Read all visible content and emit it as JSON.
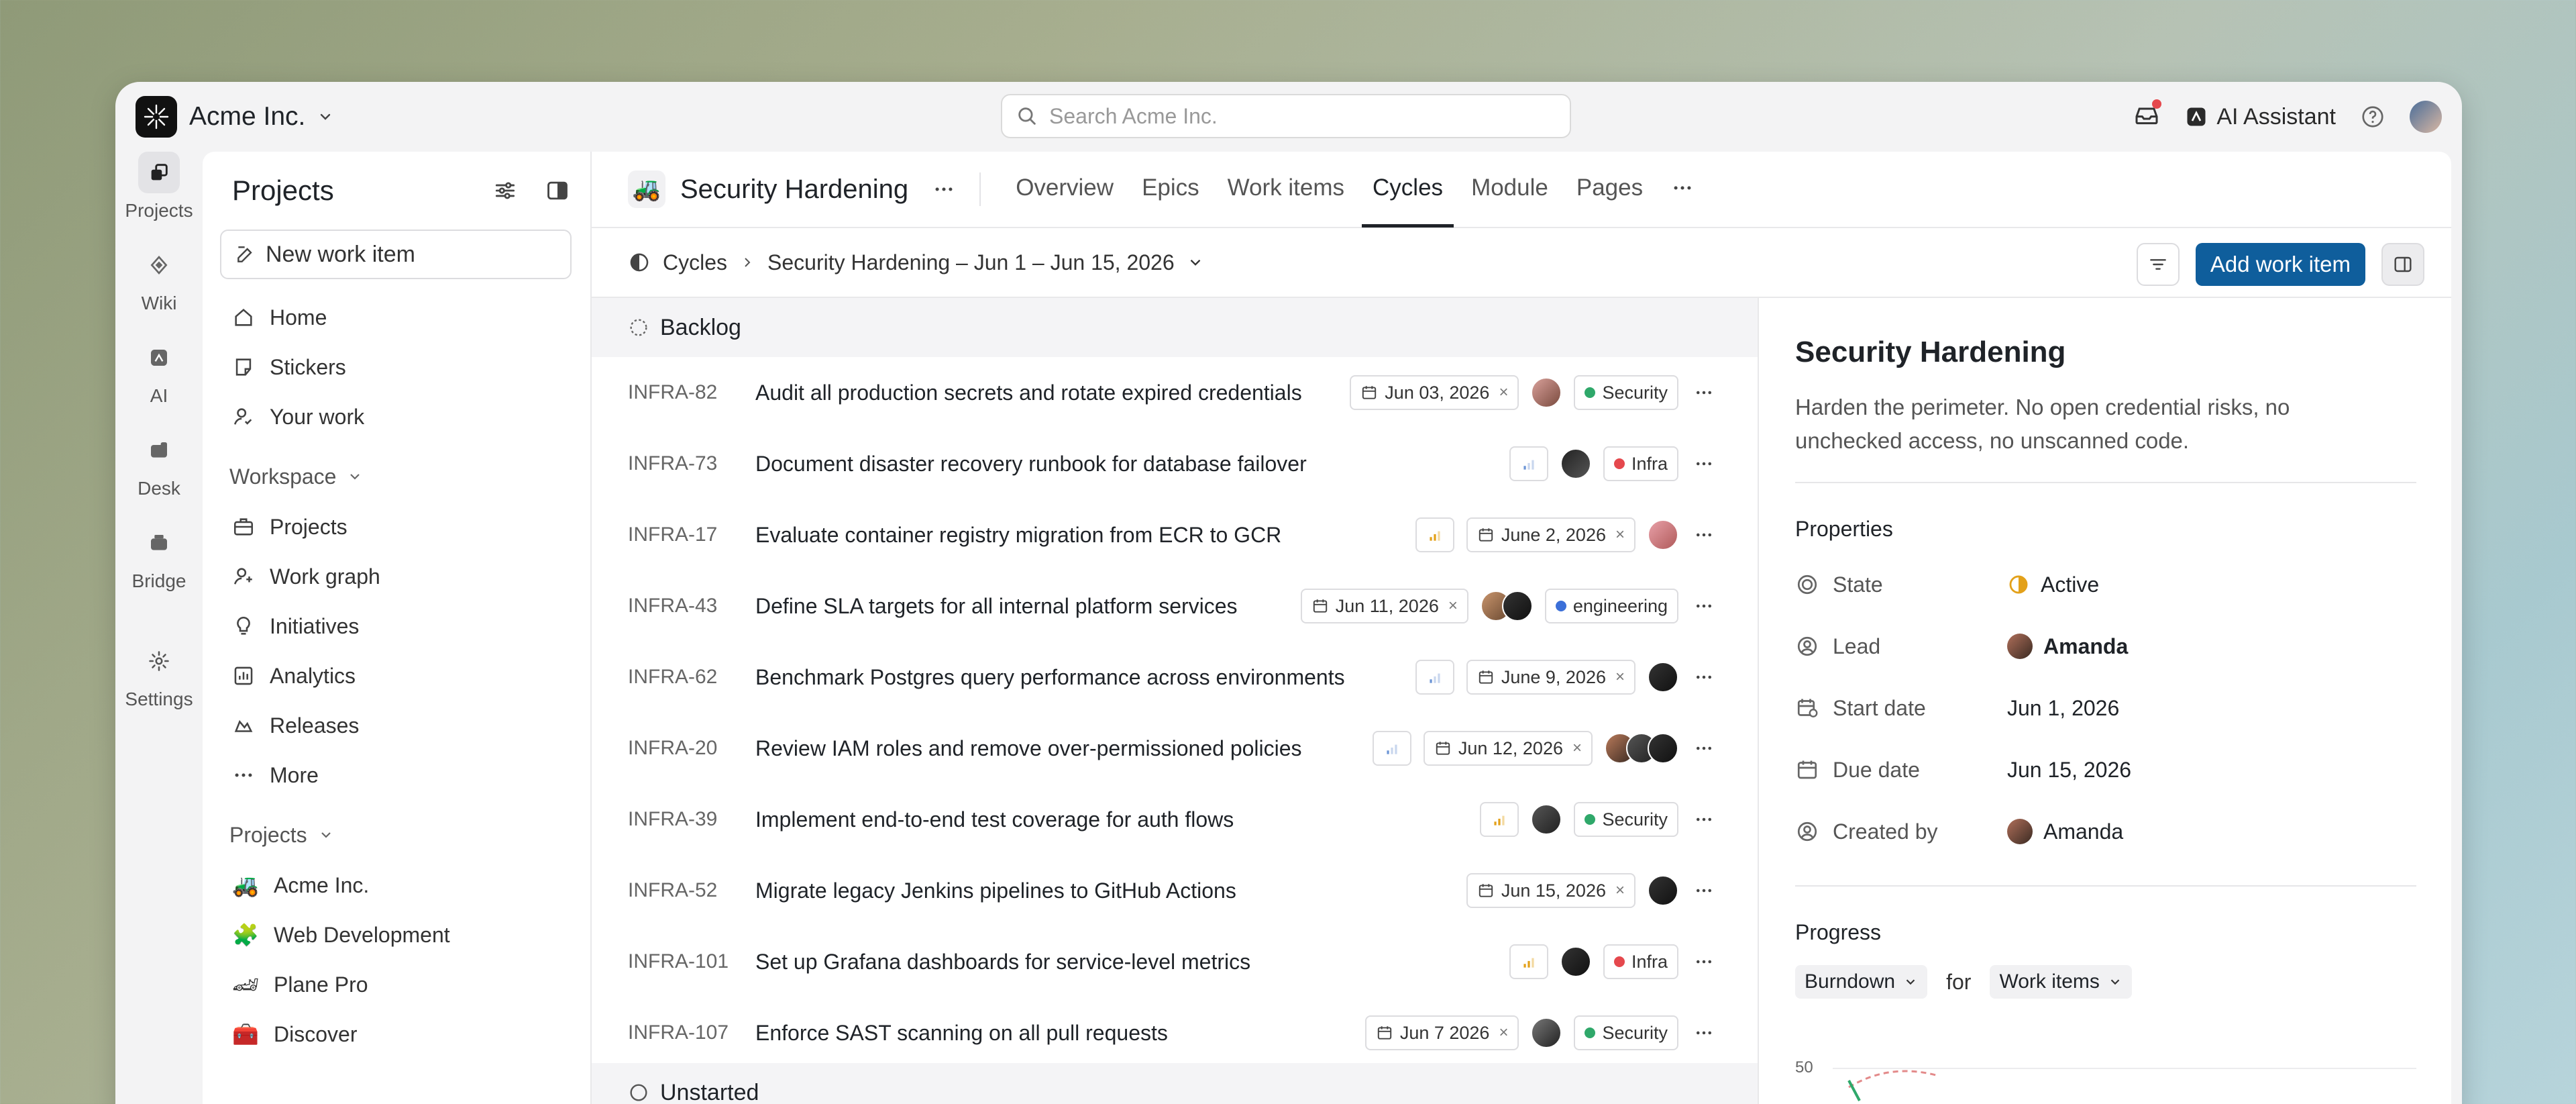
{
  "org": {
    "name": "Acme Inc."
  },
  "search": {
    "placeholder": "Search Acme Inc."
  },
  "topbar": {
    "ai_label": "AI Assistant"
  },
  "rail": [
    {
      "label": "Projects",
      "icon": "projects-icon"
    },
    {
      "label": "Wiki",
      "icon": "wiki-icon"
    },
    {
      "label": "AI",
      "icon": "ai-icon"
    },
    {
      "label": "Desk",
      "icon": "desk-icon"
    },
    {
      "label": "Bridge",
      "icon": "bridge-icon"
    },
    {
      "label": "Settings",
      "icon": "gear-icon"
    }
  ],
  "sidebar": {
    "title": "Projects",
    "new_item": "New work item",
    "top_items": [
      "Home",
      "Stickers",
      "Your work"
    ],
    "workspace_label": "Workspace",
    "workspace_items": [
      "Projects",
      "Work graph",
      "Initiatives",
      "Analytics",
      "Releases",
      "More"
    ],
    "projects_label": "Projects",
    "projects": [
      {
        "name": "Acme Inc.",
        "emoji": "🚜"
      },
      {
        "name": "Web Development",
        "emoji": "🧩"
      },
      {
        "name": "Plane Pro",
        "emoji": "🏎"
      },
      {
        "name": "Discover",
        "emoji": "🧰"
      }
    ]
  },
  "project": {
    "emoji": "🚜",
    "name": "Security Hardening",
    "tabs": [
      "Overview",
      "Epics",
      "Work items",
      "Cycles",
      "Module",
      "Pages"
    ],
    "active_tab": "Cycles"
  },
  "breadcrumb": {
    "root": "Cycles",
    "cycle": "Security Hardening – Jun 1 – Jun 15, 2026",
    "add_label": "Add work item"
  },
  "groups": {
    "backlog": "Backlog",
    "unstarted": "Unstarted"
  },
  "colors": {
    "accent": "#0f5e9c",
    "security": "#2fa86a",
    "infra": "#e5484d",
    "engineering": "#3b6fd8",
    "active": "#e3a11a"
  },
  "rows": [
    {
      "id": "INFRA-82",
      "title": "Audit all production secrets and rotate expired credentials",
      "date": "Jun 03, 2026",
      "label": "Security",
      "label_color": "#2fa86a",
      "prio": "none"
    },
    {
      "id": "INFRA-73",
      "title": "Document disaster recovery runbook for database failover",
      "date": "",
      "label": "Infra",
      "label_color": "#e5484d",
      "prio": "low"
    },
    {
      "id": "INFRA-17",
      "title": "Evaluate container registry migration from ECR to GCR",
      "date": "June 2, 2026",
      "label": "",
      "label_color": "",
      "prio": "medium"
    },
    {
      "id": "INFRA-43",
      "title": "Define SLA targets for all internal platform services",
      "date": "Jun 11, 2026",
      "label": "engineering",
      "label_color": "#3b6fd8",
      "prio": "none"
    },
    {
      "id": "INFRA-62",
      "title": "Benchmark Postgres query performance across environments",
      "date": "June 9, 2026",
      "label": "",
      "label_color": "",
      "prio": "low"
    },
    {
      "id": "INFRA-20",
      "title": "Review IAM roles and remove over-permissioned policies",
      "date": "Jun 12, 2026",
      "label": "",
      "label_color": "",
      "prio": "low"
    },
    {
      "id": "INFRA-39",
      "title": "Implement end-to-end test coverage for auth flows",
      "date": "",
      "label": "Security",
      "label_color": "#2fa86a",
      "prio": "medium"
    },
    {
      "id": "INFRA-52",
      "title": "Migrate legacy Jenkins pipelines to GitHub Actions",
      "date": "Jun 15, 2026",
      "label": "",
      "label_color": "",
      "prio": "none"
    },
    {
      "id": "INFRA-101",
      "title": "Set up Grafana dashboards for service-level metrics",
      "date": "",
      "label": "Infra",
      "label_color": "#e5484d",
      "prio": "medium"
    },
    {
      "id": "INFRA-107",
      "title": "Enforce SAST scanning on all pull requests",
      "date": "Jun 7 2026",
      "label": "Security",
      "label_color": "#2fa86a",
      "prio": "none"
    }
  ],
  "details": {
    "title": "Security Hardening",
    "description": "Harden the perimeter. No open credential risks, no unchecked access, no unscanned code.",
    "properties_label": "Properties",
    "props": {
      "state_k": "State",
      "state_v": "Active",
      "lead_k": "Lead",
      "lead_v": "Amanda",
      "start_k": "Start date",
      "start_v": "Jun 1, 2026",
      "due_k": "Due date",
      "due_v": "Jun 15, 2026",
      "created_k": "Created by",
      "created_v": "Amanda"
    },
    "progress_label": "Progress",
    "burndown": "Burndown",
    "for_label": "for",
    "work_items": "Work items",
    "chart_tick": "50"
  }
}
